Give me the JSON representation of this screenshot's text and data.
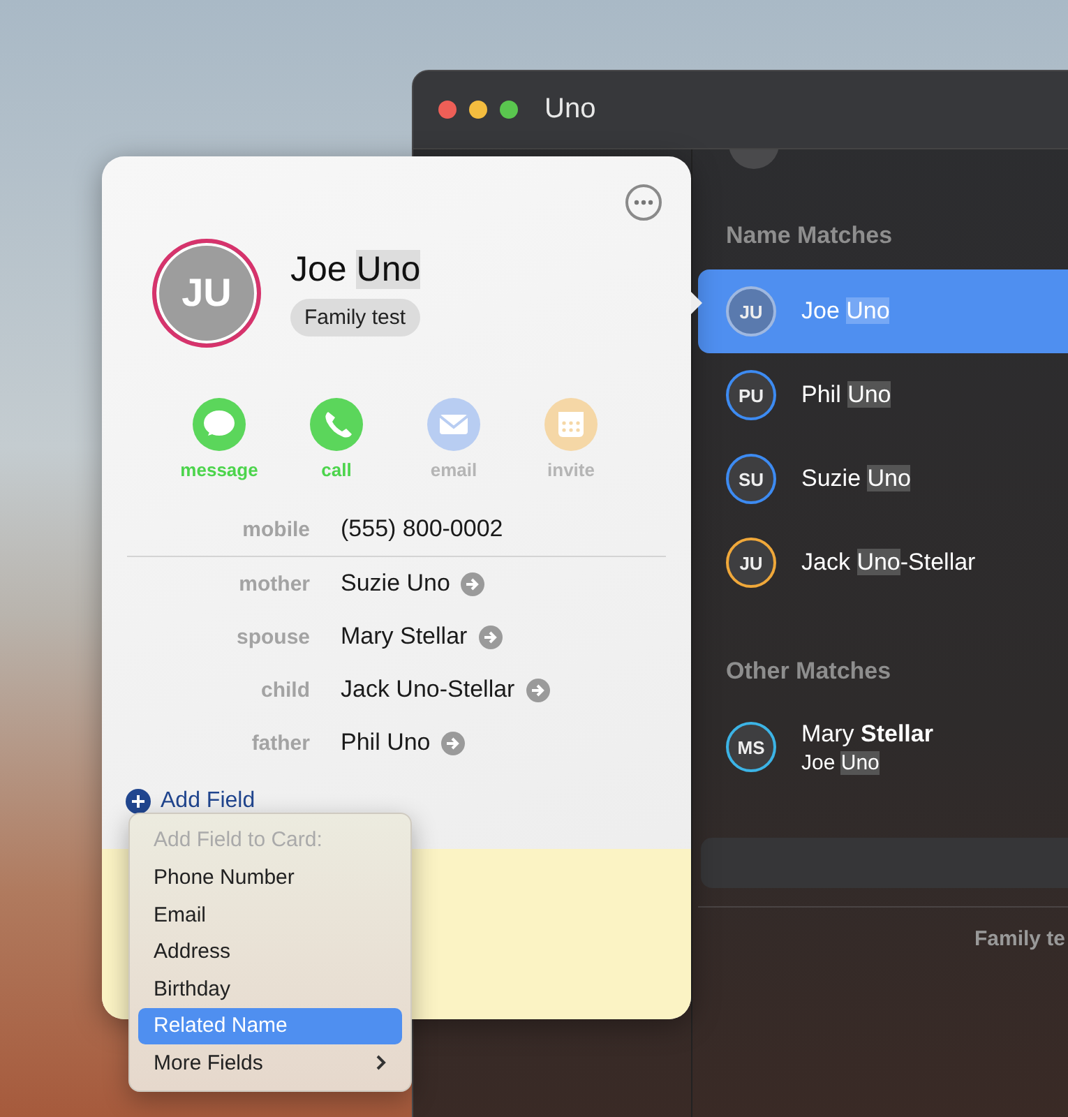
{
  "window": {
    "title": "Uno",
    "sections": [
      {
        "title": "Name Matches",
        "contacts": [
          {
            "initials": "JU",
            "color": "#9fb8e0",
            "selected": true,
            "name": [
              {
                "text": "Joe ",
                "highlighted": false
              },
              {
                "text": "Uno",
                "highlighted": true
              }
            ]
          },
          {
            "initials": "PU",
            "color": "#3d8bf2",
            "selected": false,
            "name": [
              {
                "text": "Phil ",
                "highlighted": false
              },
              {
                "text": "Uno",
                "highlighted": true
              }
            ]
          },
          {
            "initials": "SU",
            "color": "#3d8bf2",
            "selected": false,
            "name": [
              {
                "text": "Suzie ",
                "highlighted": false
              },
              {
                "text": "Uno",
                "highlighted": true
              }
            ]
          },
          {
            "initials": "JU",
            "color": "#f0a83a",
            "selected": false,
            "name": [
              {
                "text": "Jack ",
                "highlighted": false
              },
              {
                "text": "Uno",
                "highlighted": true
              },
              {
                "text": "-Stellar",
                "highlighted": false
              }
            ]
          }
        ]
      },
      {
        "title": "Other Matches",
        "contacts": [
          {
            "initials": "MS",
            "color": "#3cb4e6",
            "selected": false,
            "name": [
              {
                "text": "Mary **Stellar**",
                "highlighted": false
              }
            ],
            "detail": [
              {
                "text": "Joe ",
                "highlighted": false
              },
              {
                "text": "Uno",
                "highlighted": true
              }
            ]
          }
        ]
      }
    ],
    "footer": "Family te"
  },
  "card": {
    "initials": "JU",
    "name": [
      {
        "text": "Joe ",
        "highlighted": false
      },
      {
        "text": "Uno",
        "highlighted": true
      }
    ],
    "group": "Family test",
    "actions": [
      {
        "kind": "message",
        "label": "message",
        "disabled": false
      },
      {
        "kind": "call",
        "label": "call",
        "disabled": false
      },
      {
        "kind": "email",
        "label": "email",
        "disabled": true
      },
      {
        "kind": "invite",
        "label": "invite",
        "disabled": true
      }
    ],
    "fields": [
      {
        "kind": "phone",
        "label": "mobile",
        "value": "(555) 800-0002"
      },
      {
        "kind": "related",
        "label": "mother",
        "value": "Suzie Uno"
      },
      {
        "kind": "related",
        "label": "spouse",
        "value": "Mary Stellar"
      },
      {
        "kind": "related",
        "label": "child",
        "value": "Jack Uno-Stellar"
      },
      {
        "kind": "related",
        "label": "father",
        "value": "Phil Uno"
      }
    ],
    "add_field": "Add Field",
    "menu": {
      "header": "Add Field to Card:",
      "items": [
        {
          "label": "Phone Number",
          "selected": false,
          "submenu": false
        },
        {
          "label": "Email",
          "selected": false,
          "submenu": false
        },
        {
          "label": "Address",
          "selected": false,
          "submenu": false
        },
        {
          "label": "Birthday",
          "selected": false,
          "submenu": false
        },
        {
          "label": "Related Name",
          "selected": true,
          "submenu": false
        },
        {
          "label": "More Fields",
          "selected": false,
          "submenu": true
        }
      ]
    }
  }
}
